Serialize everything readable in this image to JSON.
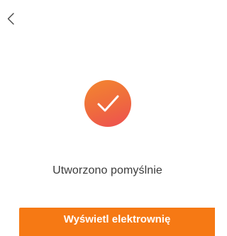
{
  "header": {
    "back_icon": "chevron-left-icon"
  },
  "result": {
    "icon": "checkmark-icon",
    "message": "Utworzono pomyślnie"
  },
  "actions": {
    "primary_label": "Wyświetl elektrownię"
  },
  "colors": {
    "accent": "#f67914",
    "icon_gradient_start": "#f3862f",
    "icon_gradient_end": "#ed4f52"
  }
}
